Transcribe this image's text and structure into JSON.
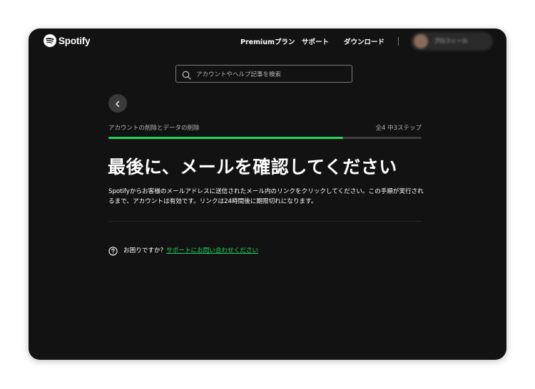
{
  "header": {
    "logo_text": "Spotify",
    "nav": {
      "premium": "Premiumプラン",
      "support": "サポート",
      "download": "ダウンロード"
    },
    "profile_name": "プロフィール"
  },
  "search": {
    "placeholder": "アカウントやヘルプ記事を検索"
  },
  "steps": {
    "label": "アカウントの削除とデータの削除",
    "count_text": "全4 中3ステップ",
    "current": 3,
    "total": 4,
    "progress": 0.75
  },
  "main": {
    "title": "最後に、メールを確認してください",
    "description": "Spotifyからお客様のメールアドレスに送信されたメール内のリンクをクリックしてください。この手順が実行されるまで、アカウントは有効です。リンクは24時間後に期限切れになります。"
  },
  "help": {
    "prefix": "お困りですか？",
    "link": "サポートにお問い合わせください"
  },
  "colors": {
    "accent": "#1ed760",
    "background": "#121212",
    "text": "#ffffff",
    "muted": "#b3b3b3"
  }
}
